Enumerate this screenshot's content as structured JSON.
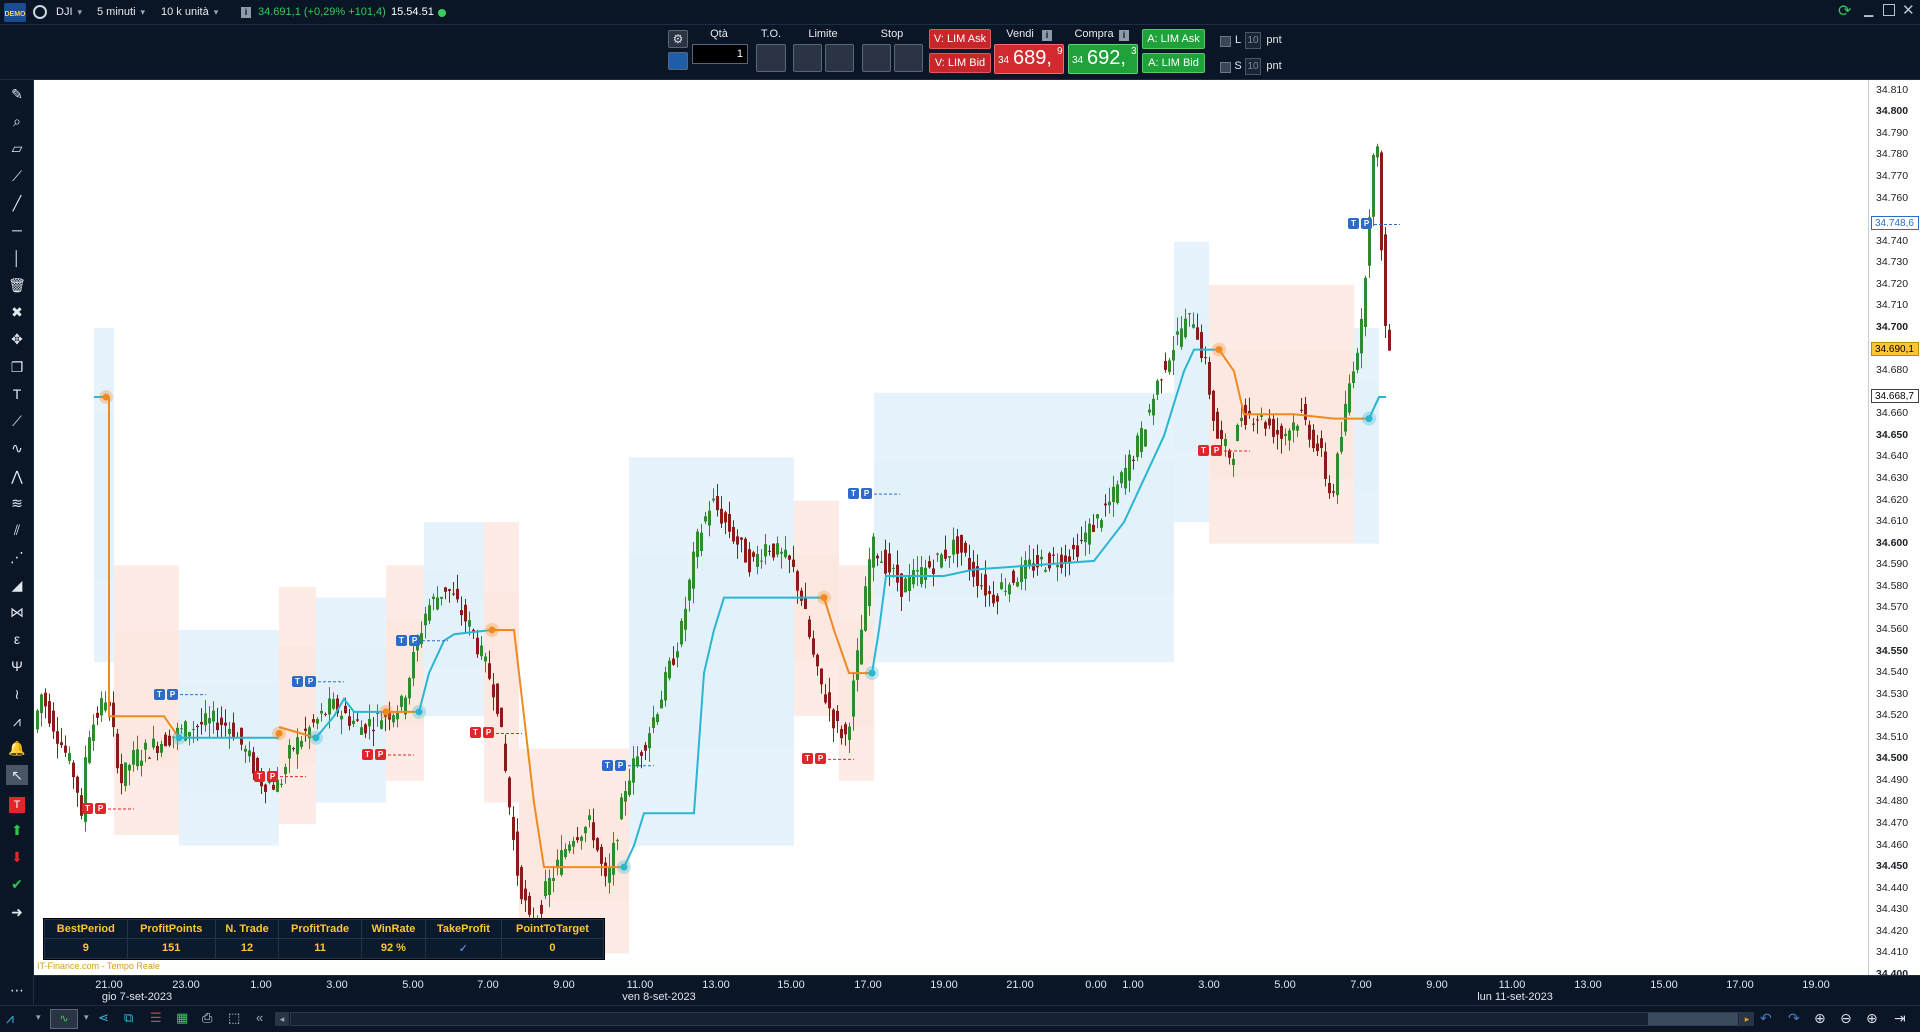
{
  "topbar": {
    "logo": "DEMO",
    "symbol": "DJI",
    "interval": "5 minuti",
    "units": "10 k unità",
    "quote": "34.691,1 (+0,29% +101,4)",
    "time": "15.54.51"
  },
  "order": {
    "qty_label": "Qtà",
    "qty_value": "1",
    "to_label": "T.O.",
    "limit_label": "Limite",
    "stop_label": "Stop",
    "v_lim_ask": "V: LIM Ask",
    "v_lim_bid": "V: LIM Bid",
    "sell_label": "Vendi",
    "sell_prefix": "34",
    "sell_price": "689,",
    "sell_sup": "9",
    "buy_label": "Compra",
    "buy_prefix": "34",
    "buy_price": "692,",
    "buy_sup": "3",
    "a_lim_ask": "A: LIM Ask",
    "a_lim_bid": "A: LIM Bid",
    "l_label": "L",
    "s_label": "S",
    "l_value": "10",
    "s_value": "10",
    "pnt": "pnt"
  },
  "yaxis": {
    "labels": [
      {
        "text": "34.810",
        "bold": false
      },
      {
        "text": "34.800",
        "bold": true
      },
      {
        "text": "34.790",
        "bold": false
      },
      {
        "text": "34.780",
        "bold": false
      },
      {
        "text": "34.770",
        "bold": false
      },
      {
        "text": "34.760",
        "bold": false
      },
      {
        "text": "34.740",
        "bold": false
      },
      {
        "text": "34.730",
        "bold": false
      },
      {
        "text": "34.720",
        "bold": false
      },
      {
        "text": "34.710",
        "bold": false
      },
      {
        "text": "34.700",
        "bold": true
      },
      {
        "text": "34.680",
        "bold": false
      },
      {
        "text": "34.660",
        "bold": false
      },
      {
        "text": "34.650",
        "bold": true
      },
      {
        "text": "34.640",
        "bold": false
      },
      {
        "text": "34.630",
        "bold": false
      },
      {
        "text": "34.620",
        "bold": false
      },
      {
        "text": "34.610",
        "bold": false
      },
      {
        "text": "34.600",
        "bold": true
      },
      {
        "text": "34.590",
        "bold": false
      },
      {
        "text": "34.580",
        "bold": false
      },
      {
        "text": "34.570",
        "bold": false
      },
      {
        "text": "34.560",
        "bold": false
      },
      {
        "text": "34.550",
        "bold": true
      },
      {
        "text": "34.540",
        "bold": false
      },
      {
        "text": "34.530",
        "bold": false
      },
      {
        "text": "34.520",
        "bold": false
      },
      {
        "text": "34.510",
        "bold": false
      },
      {
        "text": "34.500",
        "bold": true
      },
      {
        "text": "34.490",
        "bold": false
      },
      {
        "text": "34.480",
        "bold": false
      },
      {
        "text": "34.470",
        "bold": false
      },
      {
        "text": "34.460",
        "bold": false
      },
      {
        "text": "34.450",
        "bold": true
      },
      {
        "text": "34.440",
        "bold": false
      },
      {
        "text": "34.430",
        "bold": false
      },
      {
        "text": "34.420",
        "bold": false
      },
      {
        "text": "34.410",
        "bold": false
      },
      {
        "text": "34.400",
        "bold": true
      }
    ],
    "tag_blue": "34.748,6",
    "tag_yellow": "34.690,1",
    "tag_white": "34.668,7"
  },
  "xaxis": {
    "times": [
      "21.00",
      "23.00",
      "1.00",
      "3.00",
      "5.00",
      "7.00",
      "9.00",
      "11.00",
      "13.00",
      "15.00",
      "17.00",
      "19.00",
      "21.00",
      "0.00",
      "1.00",
      "3.00",
      "5.00",
      "7.00",
      "9.00",
      "11.00",
      "13.00",
      "15.00",
      "17.00",
      "19.00"
    ],
    "dates": [
      "gio 7-set-2023",
      "ven 8-set-2023",
      "lun 11-set-2023"
    ],
    "source": "IT-Finance.com - Tempo Reale"
  },
  "stats": {
    "headers": [
      "BestPeriod",
      "ProfitPoints",
      "N. Trade",
      "ProfitTrade",
      "WinRate",
      "TakeProfit",
      "PointToTarget"
    ],
    "values": [
      "9",
      "151",
      "12",
      "11",
      "92 %",
      "",
      "0"
    ]
  },
  "markers": {
    "t": "T",
    "p": "P"
  },
  "colors": {
    "bull": "#2e8b2e",
    "bear": "#8b1a1a",
    "cyan": "#2ab6d0",
    "orange": "#f08a1e",
    "yellow_tag": "#ffc533"
  },
  "chart_data": {
    "type": "candlestick",
    "ylim": [
      34400,
      34815
    ],
    "price_min": 34400,
    "price_max": 34815,
    "x_labels": [
      "21.00",
      "23.00",
      "1.00",
      "3.00",
      "5.00",
      "7.00",
      "9.00",
      "11.00",
      "13.00",
      "15.00",
      "17.00",
      "19.00",
      "21.00",
      "0.00",
      "1.00",
      "3.00",
      "5.00",
      "7.00",
      "9.00",
      "11.00",
      "13.00",
      "15.00",
      "17.00",
      "19.00"
    ],
    "last_price": 34690.1
  }
}
